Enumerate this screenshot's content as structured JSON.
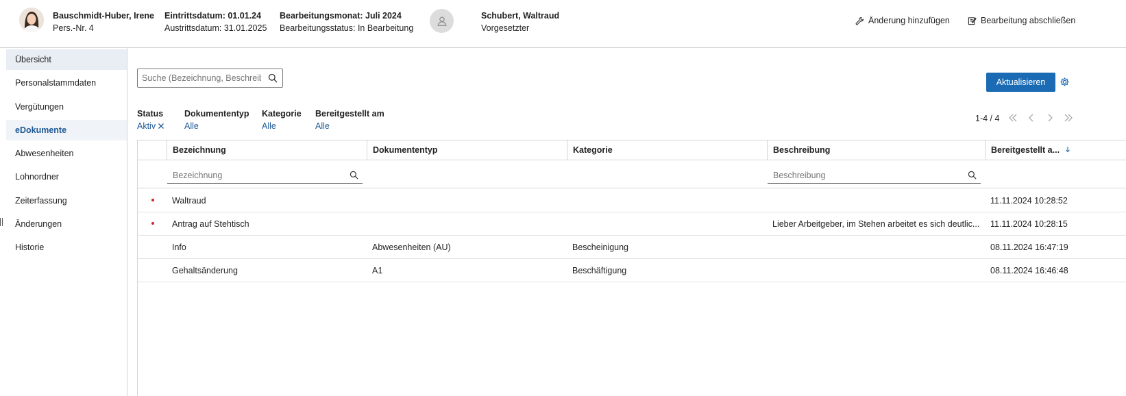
{
  "header": {
    "employee_name": "Bauschmidt-Huber, Irene",
    "employee_no": "Pers.-Nr. 4",
    "entry_date": "Eintrittsdatum: 01.01.24",
    "exit_date": "Austrittsdatum: 31.01.2025",
    "month": "Bearbeitungsmonat: Juli 2024",
    "status": "Bearbeitungsstatus: In Bearbeitung",
    "supervisor_name": "Schubert, Waltraud",
    "supervisor_role": "Vorgesetzter",
    "add_change_label": "Änderung hinzufügen",
    "finish_label": "Bearbeitung abschließen"
  },
  "sidebar": {
    "items": [
      {
        "label": "Übersicht"
      },
      {
        "label": "Personalstammdaten"
      },
      {
        "label": "Vergütungen"
      },
      {
        "label": "eDokumente"
      },
      {
        "label": "Abwesenheiten"
      },
      {
        "label": "Lohnordner"
      },
      {
        "label": "Zeiterfassung"
      },
      {
        "label": "Änderungen"
      },
      {
        "label": "Historie"
      }
    ]
  },
  "toolbar": {
    "search_placeholder": "Suche (Bezeichnung, Beschreib…",
    "refresh_label": "Aktualisieren"
  },
  "filters": {
    "status_label": "Status",
    "status_value": "Aktiv",
    "doctype_label": "Dokumententyp",
    "doctype_value": "Alle",
    "category_label": "Kategorie",
    "category_value": "Alle",
    "provided_label": "Bereitgestellt am",
    "provided_value": "Alle"
  },
  "pager": {
    "range": "1-4 / 4"
  },
  "table": {
    "columns": {
      "name": "Bezeichnung",
      "doctype": "Dokumententyp",
      "category": "Kategorie",
      "description": "Beschreibung",
      "provided": "Bereitgestellt a..."
    },
    "filter_name_placeholder": "Bezeichnung",
    "filter_desc_placeholder": "Beschreibung",
    "rows": [
      {
        "name": "Waltraud",
        "doctype": "",
        "category": "",
        "description": "",
        "provided": "11.11.2024 10:28:52",
        "unread": true
      },
      {
        "name": "Antrag auf Stehtisch",
        "doctype": "",
        "category": "",
        "description": "Lieber Arbeitgeber, im Stehen arbeitet es sich deutlic...",
        "provided": "11.11.2024 10:28:15",
        "unread": true
      },
      {
        "name": "Info",
        "doctype": "Abwesenheiten (AU)",
        "category": "Bescheinigung",
        "description": "",
        "provided": "08.11.2024 16:47:19",
        "unread": false
      },
      {
        "name": "Gehaltsänderung",
        "doctype": "A1",
        "category": "Beschäftigung",
        "description": "",
        "provided": "08.11.2024 16:46:48",
        "unread": false
      }
    ]
  },
  "colors": {
    "accent": "#1a6bb3",
    "link": "#1f5a96",
    "unread_dot": "#d2232a"
  }
}
